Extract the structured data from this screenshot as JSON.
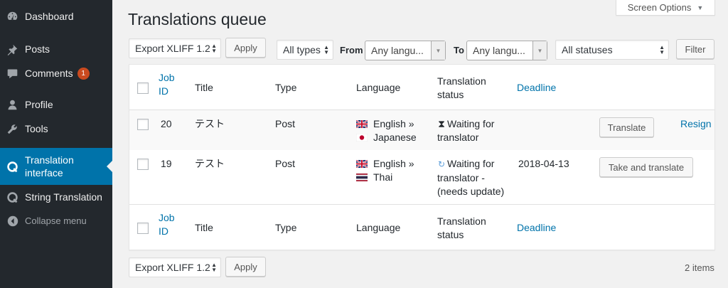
{
  "sidebar": {
    "items": [
      {
        "label": "Dashboard",
        "icon": "dashboard-icon"
      },
      {
        "label": "Posts",
        "icon": "pushpin-icon"
      },
      {
        "label": "Comments",
        "icon": "comment-icon",
        "badge": "1"
      },
      {
        "label": "Profile",
        "icon": "user-icon"
      },
      {
        "label": "Tools",
        "icon": "wrench-icon"
      },
      {
        "label": "Translation interface",
        "icon": "wpml-icon",
        "active": true
      },
      {
        "label": "String Translation",
        "icon": "wpml-icon"
      },
      {
        "label": "Collapse menu",
        "icon": "collapse-icon"
      }
    ]
  },
  "screen_options": {
    "label": "Screen Options"
  },
  "page": {
    "title": "Translations queue"
  },
  "bulk": {
    "top_select": "Export XLIFF 1.2",
    "bottom_select": "Export XLIFF 1.2",
    "apply_label": "Apply"
  },
  "filters": {
    "type_select": "All types",
    "from_label": "From",
    "from_value": "Any langu...",
    "to_label": "To",
    "to_value": "Any langu...",
    "status_select": "All statuses",
    "filter_button": "Filter"
  },
  "table": {
    "columns": {
      "job_id": [
        "Job",
        "ID"
      ],
      "title": "Title",
      "type": "Type",
      "language": "Language",
      "status": [
        "Translation",
        "status"
      ],
      "deadline": "Deadline"
    },
    "rows": [
      {
        "id": "20",
        "title": "テスト",
        "type": "Post",
        "from_lang": "English »",
        "to_lang": "Japanese",
        "status_lines": [
          "Waiting for",
          "translator"
        ],
        "status_icon": "hourglass-icon",
        "deadline": "",
        "action": "Translate",
        "extra_link": "Resign"
      },
      {
        "id": "19",
        "title": "テスト",
        "type": "Post",
        "from_lang": "English »",
        "to_lang": "Thai",
        "status_lines": [
          "Waiting for",
          "translator -",
          "(needs update)"
        ],
        "status_icon": "refresh-icon",
        "deadline": "2018-04-13",
        "action": "Take and translate",
        "extra_link": ""
      }
    ]
  },
  "items_count": "2 items",
  "colors": {
    "sidebar_bg": "#23282d",
    "active_bg": "#0073aa",
    "link": "#0073aa",
    "badge": "#ca4a1f",
    "page_bg": "#f1f1f1"
  }
}
